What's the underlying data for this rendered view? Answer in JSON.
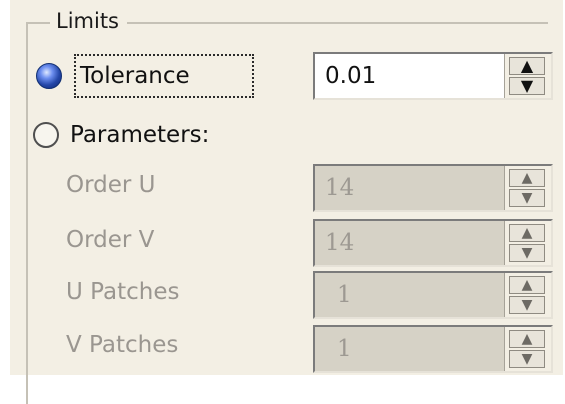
{
  "groupbox": {
    "title": "Limits"
  },
  "tolerance": {
    "label": "Tolerance",
    "value": "0.01",
    "selected": true
  },
  "parameters": {
    "label": "Parameters:",
    "selected": false,
    "fields": [
      {
        "label": "Order U",
        "value": "14"
      },
      {
        "label": "Order V",
        "value": "14"
      },
      {
        "label": "U Patches",
        "value": "1"
      },
      {
        "label": "V Patches",
        "value": "1"
      }
    ]
  },
  "icons": {
    "spin_up": "spin-up-icon",
    "spin_down": "spin-down-icon"
  }
}
